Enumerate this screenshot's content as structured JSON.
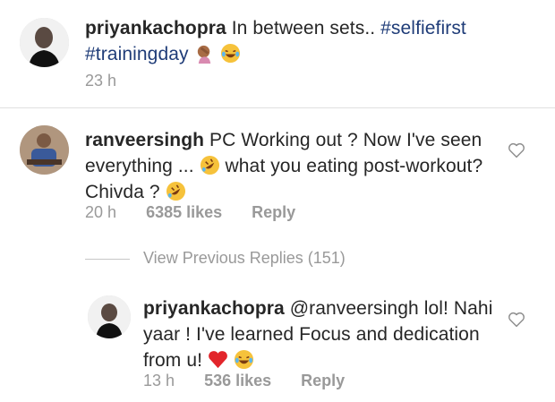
{
  "post": {
    "username": "priyankachopra",
    "caption": "In between sets.. ",
    "tags": [
      "#selfiefirst",
      "#trainingday"
    ],
    "time": "23 h"
  },
  "comment": {
    "username": "ranveersingh",
    "text_1": "PC Working out ? Now I've seen",
    "text_2": "everything ...",
    "text_3": "what you eating post-workout?",
    "text_4": "Chivda ?",
    "time": "20 h",
    "likes": "6385 likes",
    "reply": "Reply"
  },
  "view_replies": "View Previous Replies (151)",
  "reply": {
    "username": "priyankachopra",
    "mention": "@ranveersingh",
    "text_1": "lol! Nahi",
    "text_2": "yaar ! I've learned Focus and dedication",
    "text_3": "from u!",
    "time": "13 h",
    "likes": "536 likes",
    "reply": "Reply"
  },
  "colors": {
    "hashtag": "#1f3c78",
    "meta": "#999999",
    "heart": "#e2252b"
  }
}
